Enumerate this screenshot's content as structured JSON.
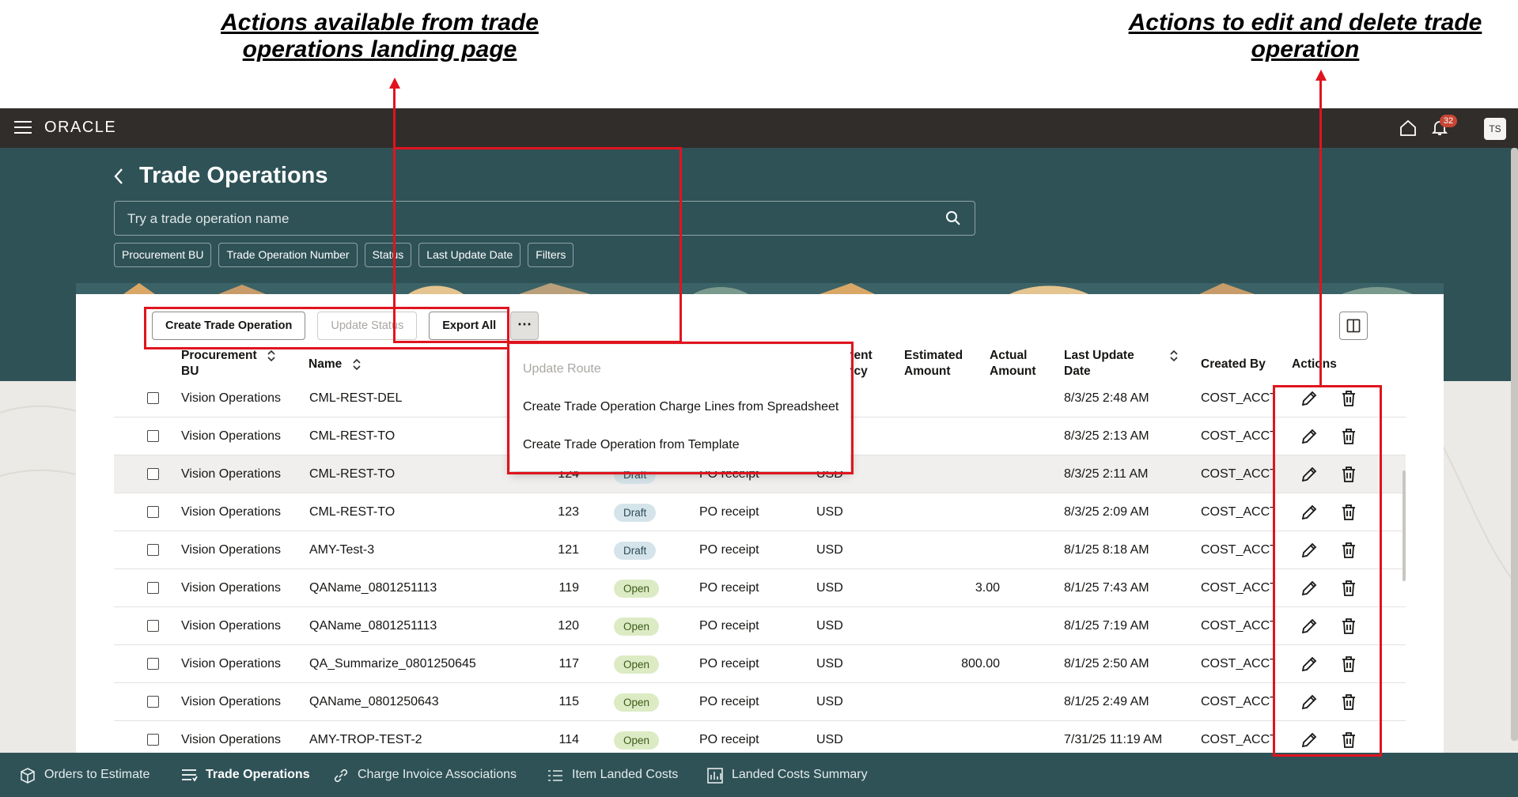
{
  "annotations": {
    "left_callout": "Actions available from trade operations landing page",
    "right_callout": "Actions to edit and delete trade operation"
  },
  "header": {
    "brand": "ORACLE",
    "notification_count": "32",
    "avatar_initials": "TS"
  },
  "page": {
    "title": "Trade Operations",
    "search_placeholder": "Try a trade operation name",
    "filters": [
      "Procurement BU",
      "Trade Operation Number",
      "Status",
      "Last Update Date",
      "Filters"
    ]
  },
  "toolbar": {
    "create_label": "Create Trade Operation",
    "update_status_label": "Update Status",
    "export_label": "Export All",
    "more_label": "⋯"
  },
  "menu": {
    "items": [
      "Update Route",
      "Create Trade Operation Charge Lines from Spreadsheet",
      "Create Trade Operation from Template"
    ]
  },
  "table": {
    "headers": {
      "bu_line1": "Procurement",
      "bu_line2": "BU",
      "name": "Name",
      "currency_line1": "nent",
      "currency_line2": "ncy",
      "estimated_line1": "Estimated",
      "estimated_line2": "Amount",
      "actual_line1": "Actual",
      "actual_line2": "Amount",
      "last_update_line1": "Last Update",
      "last_update_line2": "Date",
      "created_by": "Created By",
      "actions": "Actions"
    },
    "rows": [
      {
        "bu": "Vision Operations",
        "name": "CML-REST-DEL",
        "number": "",
        "status": "",
        "status_type": "",
        "route": "",
        "currency": "",
        "estimated": "",
        "actual": "",
        "last_update": "8/3/25 2:48 AM",
        "created_by": "COST_ACCT_"
      },
      {
        "bu": "Vision Operations",
        "name": "CML-REST-TO",
        "number": "",
        "status": "",
        "status_type": "",
        "route": "",
        "currency": "",
        "estimated": "",
        "actual": "",
        "last_update": "8/3/25 2:13 AM",
        "created_by": "COST_ACCT_"
      },
      {
        "bu": "Vision Operations",
        "name": "CML-REST-TO",
        "number": "124",
        "status": "Draft",
        "status_type": "draft",
        "route": "PO receipt",
        "currency": "USD",
        "estimated": "",
        "actual": "",
        "last_update": "8/3/25 2:11 AM",
        "created_by": "COST_ACCT_"
      },
      {
        "bu": "Vision Operations",
        "name": "CML-REST-TO",
        "number": "123",
        "status": "Draft",
        "status_type": "draft",
        "route": "PO receipt",
        "currency": "USD",
        "estimated": "",
        "actual": "",
        "last_update": "8/3/25 2:09 AM",
        "created_by": "COST_ACCT_"
      },
      {
        "bu": "Vision Operations",
        "name": "AMY-Test-3",
        "number": "121",
        "status": "Draft",
        "status_type": "draft",
        "route": "PO receipt",
        "currency": "USD",
        "estimated": "",
        "actual": "",
        "last_update": "8/1/25 8:18 AM",
        "created_by": "COST_ACCT_"
      },
      {
        "bu": "Vision Operations",
        "name": "QAName_0801251113",
        "number": "119",
        "status": "Open",
        "status_type": "open",
        "route": "PO receipt",
        "currency": "USD",
        "estimated": "3.00",
        "actual": "",
        "last_update": "8/1/25 7:43 AM",
        "created_by": "COST_ACCT_"
      },
      {
        "bu": "Vision Operations",
        "name": "QAName_0801251113",
        "number": "120",
        "status": "Open",
        "status_type": "open",
        "route": "PO receipt",
        "currency": "USD",
        "estimated": "",
        "actual": "",
        "last_update": "8/1/25 7:19 AM",
        "created_by": "COST_ACCT_"
      },
      {
        "bu": "Vision Operations",
        "name": "QA_Summarize_0801250645",
        "number": "117",
        "status": "Open",
        "status_type": "open",
        "route": "PO receipt",
        "currency": "USD",
        "estimated": "800.00",
        "actual": "",
        "last_update": "8/1/25 2:50 AM",
        "created_by": "COST_ACCT_"
      },
      {
        "bu": "Vision Operations",
        "name": "QAName_0801250643",
        "number": "115",
        "status": "Open",
        "status_type": "open",
        "route": "PO receipt",
        "currency": "USD",
        "estimated": "",
        "actual": "",
        "last_update": "8/1/25 2:49 AM",
        "created_by": "COST_ACCT_"
      },
      {
        "bu": "Vision Operations",
        "name": "AMY-TROP-TEST-2",
        "number": "114",
        "status": "Open",
        "status_type": "open",
        "route": "PO receipt",
        "currency": "USD",
        "estimated": "",
        "actual": "",
        "last_update": "7/31/25 11:19 AM",
        "created_by": "COST_ACCT_"
      }
    ]
  },
  "bottom_nav": {
    "items": [
      {
        "label": "Orders to Estimate",
        "icon": "orders-icon"
      },
      {
        "label": "Trade Operations",
        "icon": "trade-operations-icon",
        "active": true
      },
      {
        "label": "Charge Invoice Associations",
        "icon": "link-icon"
      },
      {
        "label": "Item Landed Costs",
        "icon": "list-icon"
      },
      {
        "label": "Landed Costs Summary",
        "icon": "chart-icon"
      }
    ]
  },
  "colors": {
    "annotation_red": "#e0141e",
    "header_bg": "#312d2a",
    "hero_bg": "#2f5257",
    "draft_badge": "#d4e4ea",
    "open_badge": "#dcebc4"
  }
}
